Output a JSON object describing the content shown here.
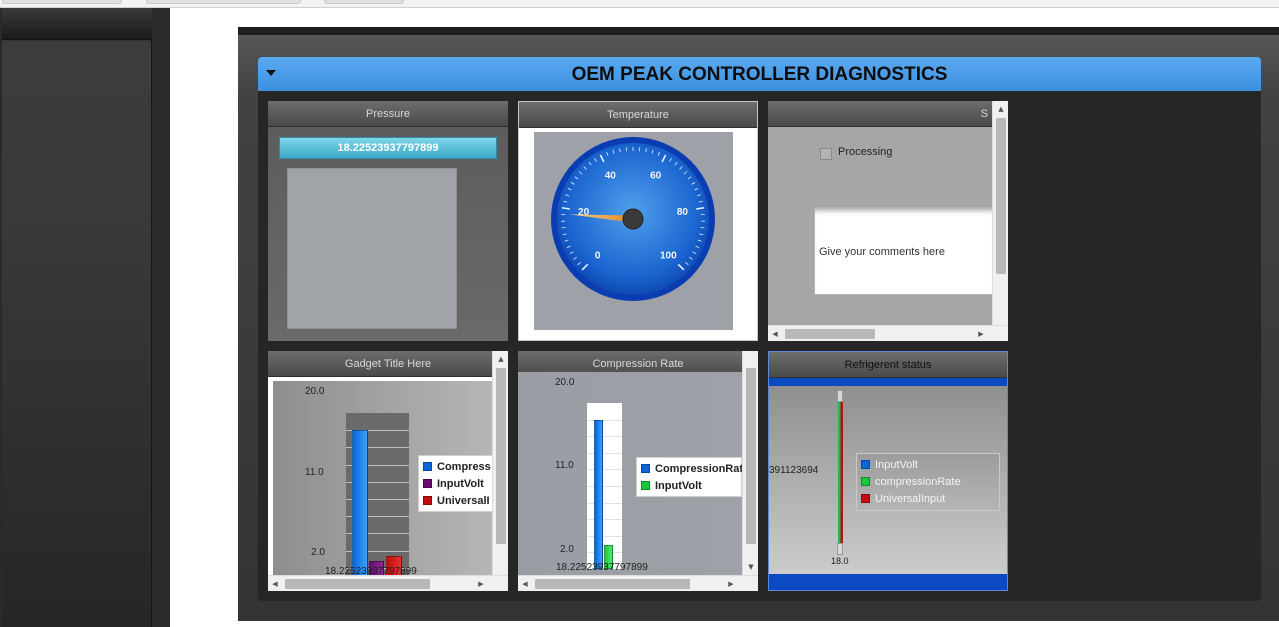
{
  "dashboard": {
    "title": "OEM PEAK CONTROLLER DIAGNOSTICS"
  },
  "gadgets": {
    "pressure": {
      "title": "Pressure",
      "value": "18.22523937797899"
    },
    "temperature": {
      "title": "Temperature",
      "gauge": {
        "ticks": [
          "0",
          "20",
          "40",
          "60",
          "80",
          "100"
        ],
        "min": 0,
        "max": 100,
        "value": 18.2
      }
    },
    "status": {
      "title": "S",
      "checkbox_label": "Processing",
      "checkbox_checked": false,
      "comment_placeholder": "Give your comments here"
    },
    "gadget_title": {
      "title": "Gadget Title Here",
      "x_label": "18.22523937797899"
    },
    "compression_rate": {
      "title": "Compression Rate",
      "x_label": "18.22523937797899"
    },
    "refrigerent": {
      "title": "Refrigerent status",
      "side_value": "391123694",
      "bottom_value": "18.0"
    }
  },
  "colors": {
    "accent": "#3c90e0",
    "series_blue": "#0a66d8",
    "series_purple": "#6a0a72",
    "series_red": "#c40e0e",
    "series_green": "#18c83a"
  },
  "chart_data": [
    {
      "type": "bar",
      "categories": [
        "18.22523937797899"
      ],
      "series": [
        {
          "name": "Compress",
          "values": [
            18.2
          ]
        },
        {
          "name": "InputVolt",
          "values": [
            3.5
          ]
        },
        {
          "name": "UniversalI",
          "values": [
            4.0
          ]
        }
      ],
      "yticks": [
        "20.0",
        "11.0",
        "2.0"
      ],
      "ylim": [
        2,
        20
      ]
    },
    {
      "type": "bar",
      "categories": [
        "18.22523937797899"
      ],
      "series": [
        {
          "name": "CompressionRat",
          "values": [
            18.2
          ]
        },
        {
          "name": "InputVolt",
          "values": [
            3.5
          ]
        }
      ],
      "yticks": [
        "20.0",
        "11.0",
        "2.0"
      ],
      "ylim": [
        2,
        20
      ]
    },
    {
      "type": "bar",
      "series": [
        {
          "name": "InputVolt"
        },
        {
          "name": "compressionRate"
        },
        {
          "name": "UniversalInput"
        }
      ]
    }
  ]
}
